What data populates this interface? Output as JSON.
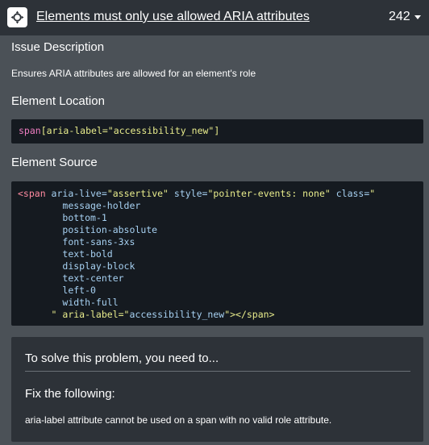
{
  "header": {
    "issue_icon": "crosshair-move-icon",
    "title": "Elements must only use allowed ARIA attributes",
    "count": "242",
    "chevron_icon": "chevron-down-icon"
  },
  "description": {
    "heading": "Issue Description",
    "text": "Ensures ARIA attributes are allowed for an element's role"
  },
  "location": {
    "heading": "Element Location",
    "selector_tag": "span",
    "selector_rest": "[aria-label=\"accessibility_new\"]"
  },
  "source": {
    "heading": "Element Source",
    "lines": [
      "<span aria-live=\"assertive\" style=\"pointer-events: none\" class=\"",
      "        message-holder",
      "        bottom-1",
      "        position-absolute",
      "        font-sans-3xs",
      "        text-bold",
      "        display-block",
      "        text-center",
      "        left-0",
      "        width-full",
      "      \" aria-label=\"accessibility_new\"></span>"
    ]
  },
  "solve": {
    "heading": "To solve this problem, you need to...",
    "fix_heading": "Fix the following:",
    "fix_text": "aria-label attribute cannot be used on a span with no valid role attribute."
  },
  "colors": {
    "background": "#4b5157",
    "header": "#2d3238",
    "code_background": "#151a20",
    "attr_name": "#a7d1f2",
    "attr_value": "#e8ec8c",
    "tag_name": "#ff8aa0"
  }
}
